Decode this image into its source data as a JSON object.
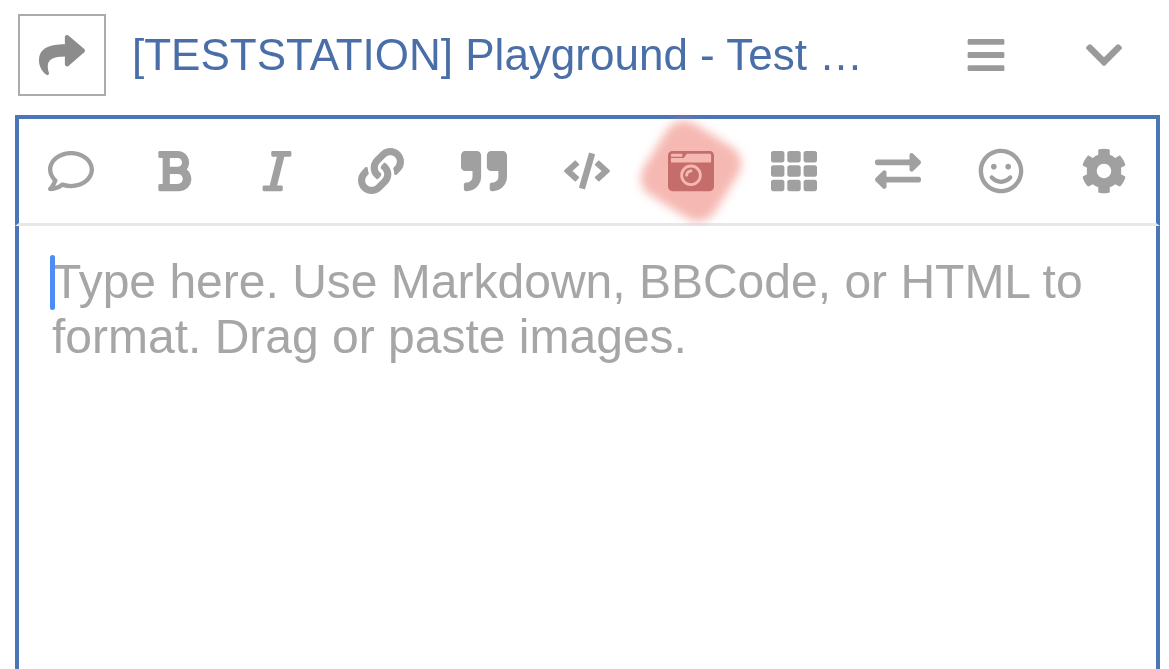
{
  "header": {
    "title": "[TESTSTATION] Playground - Test …"
  },
  "toolbar": [
    {
      "pressed": false
    },
    {
      "pressed": false
    },
    {
      "pressed": false
    },
    {
      "pressed": false
    },
    {
      "pressed": false
    },
    {
      "pressed": false
    },
    {
      "pressed": true
    },
    {
      "pressed": false
    },
    {
      "pressed": false
    },
    {
      "pressed": false
    },
    {
      "pressed": false
    }
  ],
  "editor": {
    "placeholder": "Type here. Use Markdown, BBCode, or HTML to format. Drag or paste images.",
    "focused": true
  }
}
